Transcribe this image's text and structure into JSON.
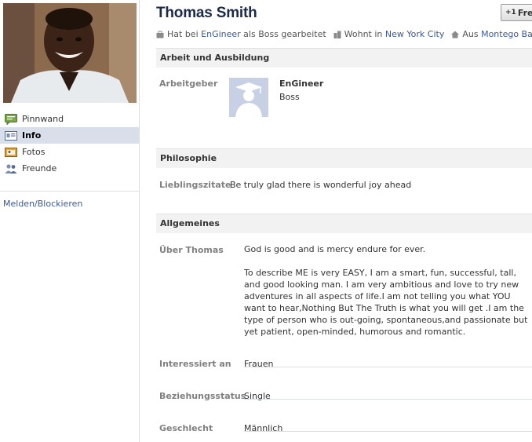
{
  "profile": {
    "name": "Thomas Smith",
    "add_friend_label": "Fre",
    "info": {
      "work_prefix": "Hat bei",
      "work_company": "EnGineer",
      "work_suffix": "als Boss gearbeitet",
      "lives_prefix": "Wohnt in",
      "lives_city": "New York City",
      "from_prefix": "Aus",
      "from_city": "Montego Bay"
    }
  },
  "nav": {
    "items": [
      {
        "label": "Pinnwand",
        "icon": "wall-icon"
      },
      {
        "label": "Info",
        "icon": "info-icon"
      },
      {
        "label": "Fotos",
        "icon": "photos-icon"
      },
      {
        "label": "Freunde",
        "icon": "friends-icon"
      }
    ],
    "active": "Info",
    "report_link": "Melden/Blockieren"
  },
  "sections": {
    "work": {
      "title": "Arbeit und Ausbildung",
      "employer_label": "Arbeitgeber",
      "employer_name": "EnGineer",
      "employer_role": "Boss"
    },
    "philosophy": {
      "title": "Philosophie",
      "quotes_label": "Lieblingszitate",
      "quotes_value": "Be truly glad there is wonderful joy ahead"
    },
    "general": {
      "title": "Allgemeines",
      "about_label": "Über Thomas",
      "about_p1": "God is good and is mercy endure for ever.",
      "about_p2": "To describe ME is very EASY, I am a smart, fun, successful, tall, and good looking man. I am very ambitious and love to try new adventures in all aspects of life.I am not telling you what YOU want to hear,Nothing But The Truth is what you will get .I am the type of person who is out-going, spontaneous,and passionate but yet patient, open-minded, humorous and romantic.",
      "interested_label": "Interessiert an",
      "interested_value": "Frauen",
      "relationship_label": "Beziehungsstatus",
      "relationship_value": "Single",
      "gender_label": "Geschlecht",
      "gender_value": "Männlich"
    }
  },
  "colors": {
    "link": "#3b5998",
    "name": "#1c2a47",
    "nav_active_bg": "#d8dfea",
    "section_bg": "#f2f2f2"
  }
}
